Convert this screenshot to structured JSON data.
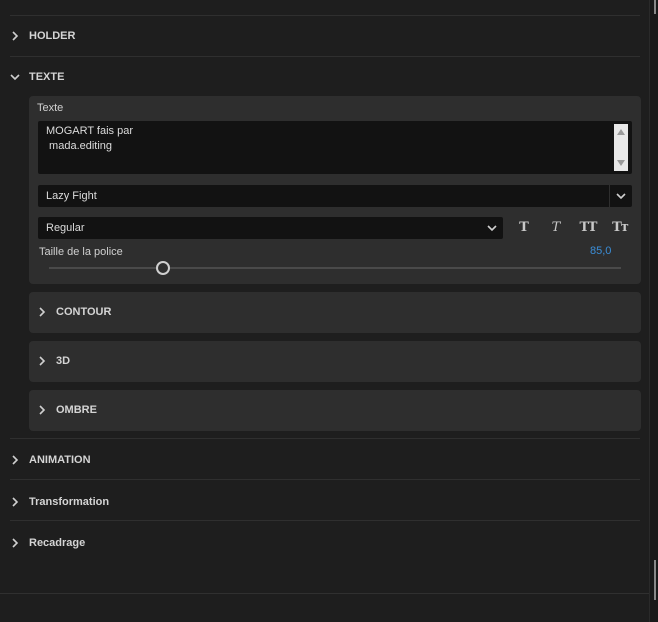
{
  "sections": {
    "holder": "HOLDER",
    "texte": "TEXTE",
    "animation": "ANIMATION",
    "transformation": "Transformation",
    "recadrage": "Recadrage"
  },
  "texte": {
    "field_label": "Texte",
    "text_lines": [
      "MOGART fais par",
      " mada.editing"
    ],
    "font": "Lazy Fight",
    "style": "Regular",
    "format_buttons": [
      "T",
      "T",
      "TT",
      "Tт"
    ],
    "size_label": "Taille de la police",
    "size_value": "85,0",
    "size_slider_fraction": 0.2
  },
  "subsections": {
    "contour": "CONTOUR",
    "three_d": "3D",
    "ombre": "OMBRE"
  },
  "icons": {
    "collapsed": "chevron-right-icon",
    "expanded": "chevron-down-icon",
    "dropdown": "chevron-down-icon"
  },
  "colors": {
    "background": "#1e1e1e",
    "card": "#2e2e2e",
    "field": "#121212",
    "accent": "#3b8ed8"
  }
}
